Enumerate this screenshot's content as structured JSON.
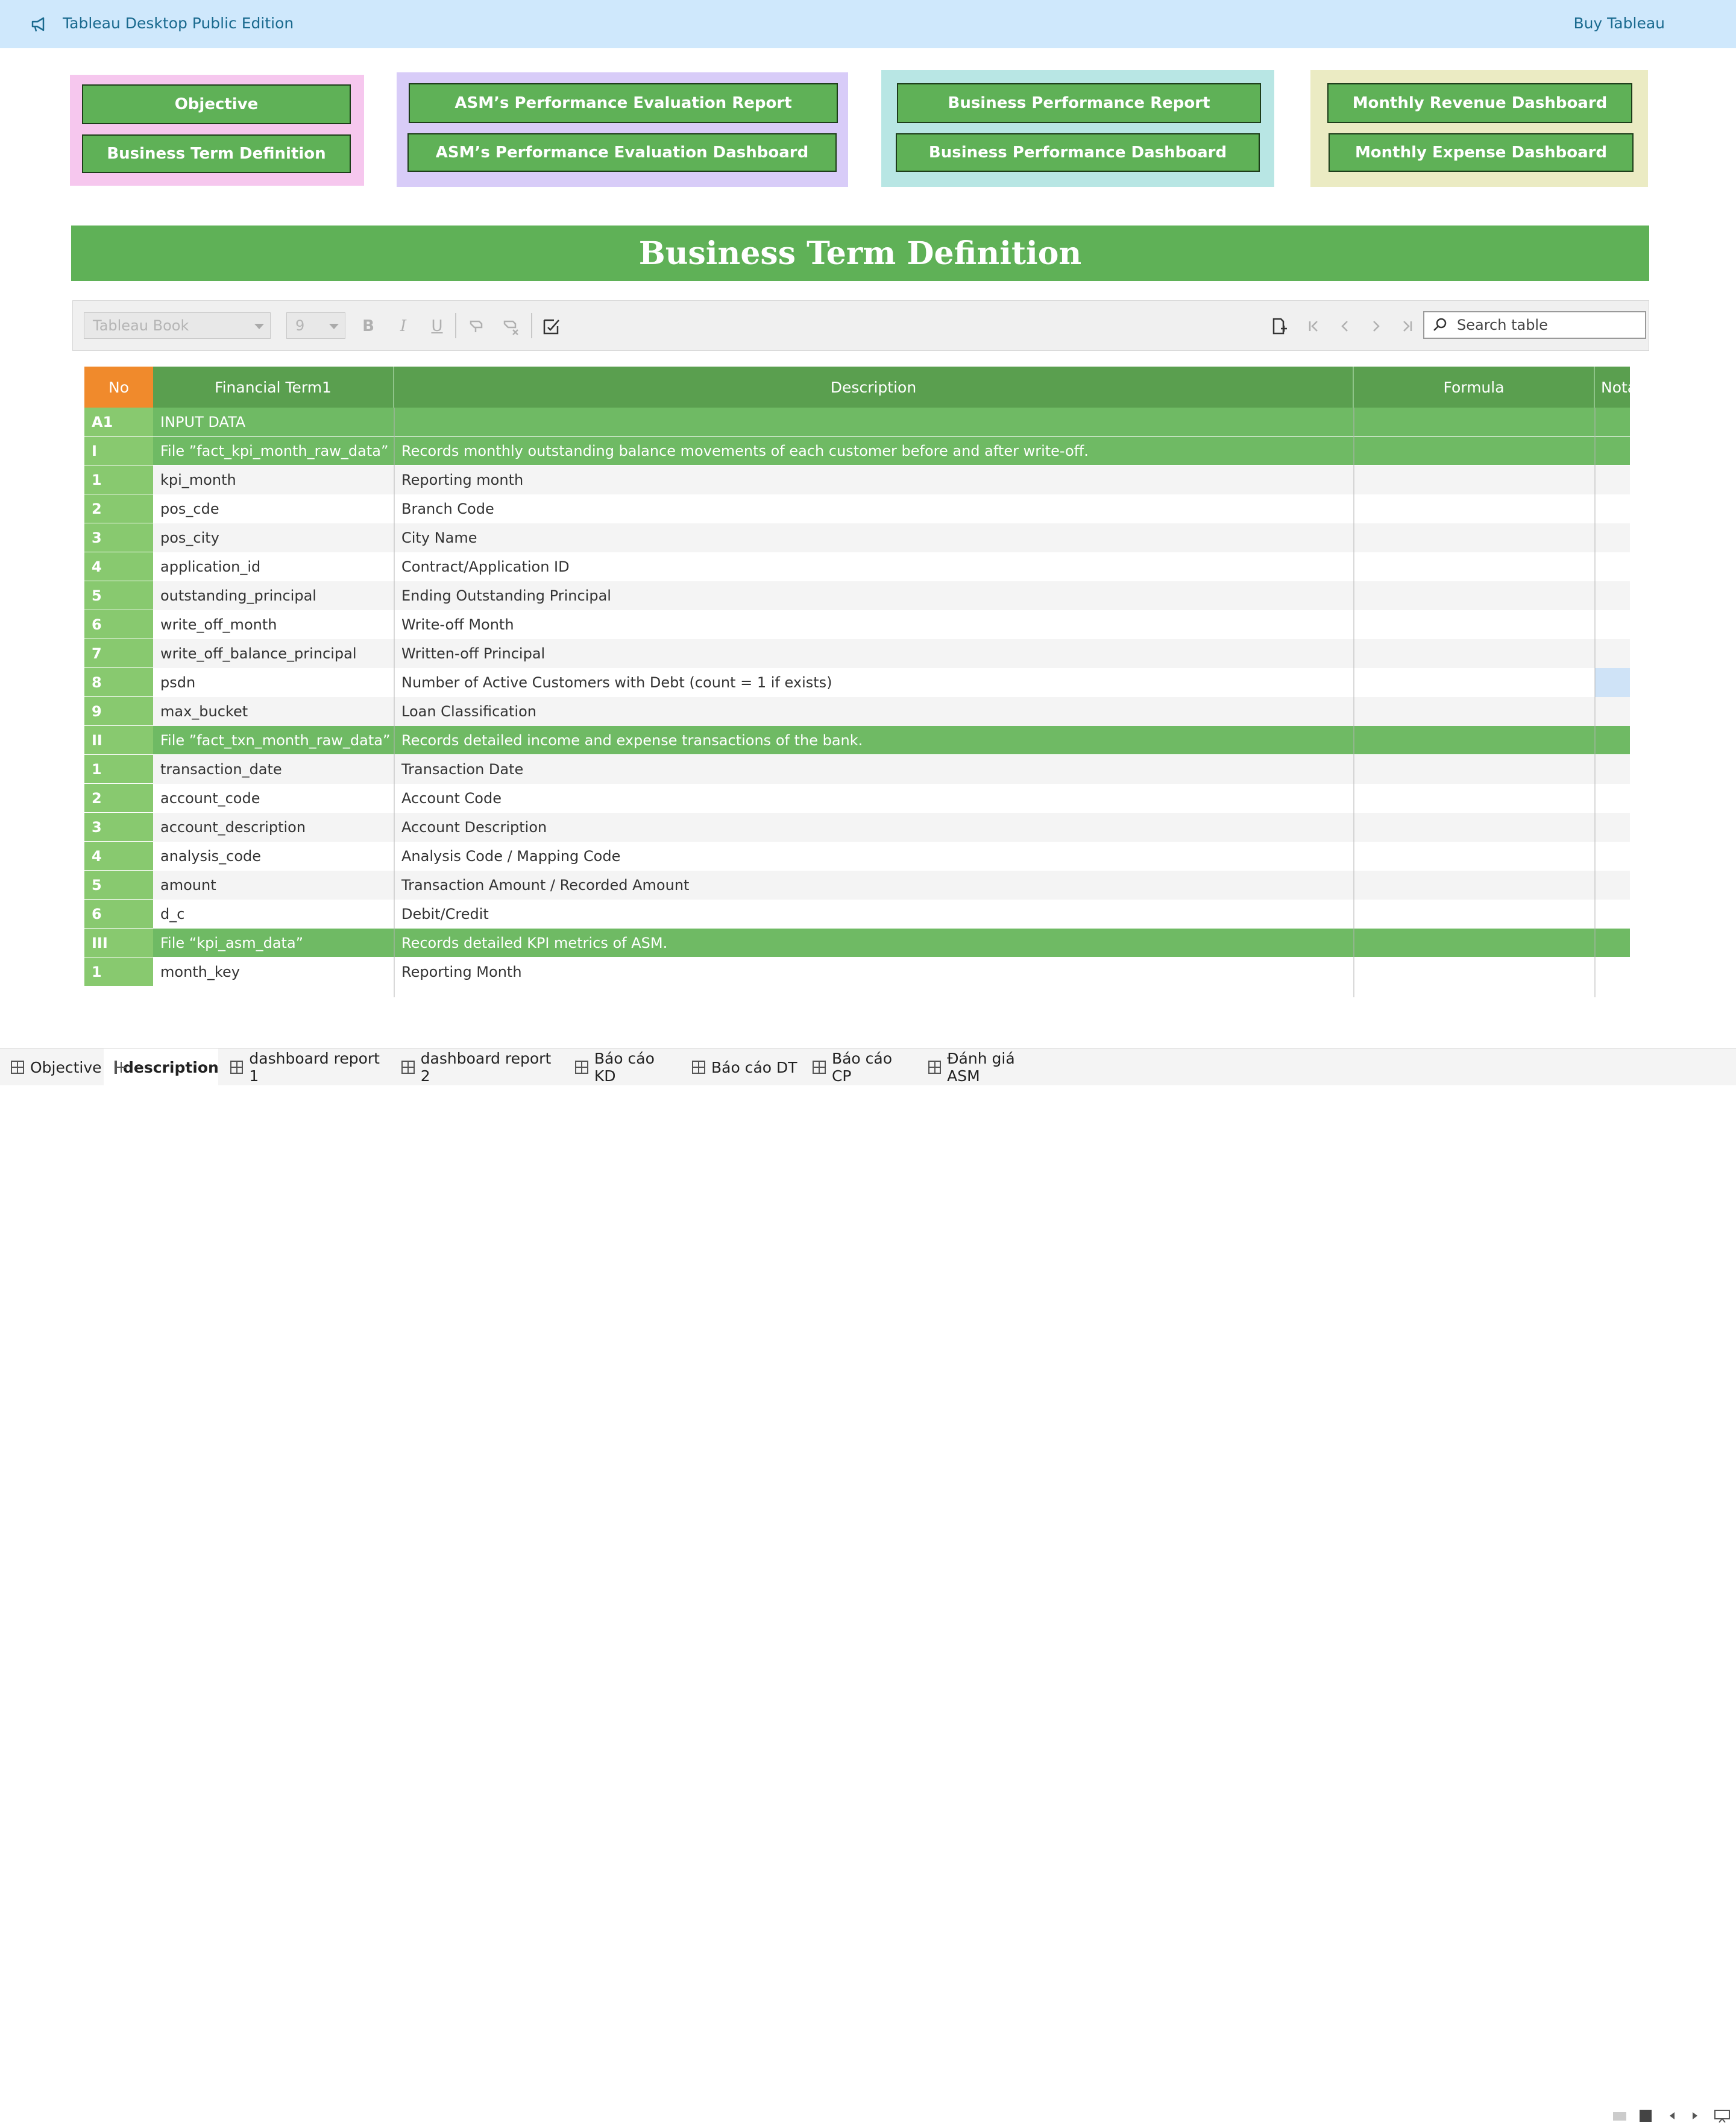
{
  "app": {
    "title": "Tableau Desktop Public Edition",
    "buy_label": "Buy Tableau",
    "icon": "megaphone-icon"
  },
  "nav": {
    "groups": [
      {
        "bg": "#f6c7ee",
        "buttons": [
          "Objective",
          "Business Term Definition"
        ]
      },
      {
        "bg": "#d8ccf8",
        "buttons": [
          "ASM’s Performance Evaluation Report",
          "ASM’s Performance Evaluation Dashboard"
        ]
      },
      {
        "bg": "#b8e6e4",
        "buttons": [
          "Business Performance Report",
          "Business Performance Dashboard"
        ]
      },
      {
        "bg": "#ebebc3",
        "buttons": [
          "Monthly Revenue Dashboard",
          "Monthly Expense Dashboard"
        ]
      }
    ]
  },
  "banner": {
    "title": "Business Term Definition"
  },
  "toolbar": {
    "font_name": "Tableau Book",
    "font_size": "9",
    "search_placeholder": "Search table"
  },
  "table": {
    "headers": [
      "No",
      "Financial Term1",
      "Description",
      "Formula",
      "Nota"
    ],
    "rows": [
      {
        "no": "A1",
        "term": "INPUT DATA",
        "desc": "",
        "kind": "section"
      },
      {
        "no": "I",
        "term": "File ”fact_kpi_month_raw_data”",
        "desc": "Records monthly outstanding balance movements of each customer before and after write-off.",
        "kind": "section"
      },
      {
        "no": "1",
        "term": "kpi_month",
        "desc": "Reporting month",
        "kind": "data"
      },
      {
        "no": "2",
        "term": "pos_cde",
        "desc": "Branch Code",
        "kind": "data"
      },
      {
        "no": "3",
        "term": "pos_city",
        "desc": "City Name",
        "kind": "data"
      },
      {
        "no": "4",
        "term": "application_id",
        "desc": "Contract/Application ID",
        "kind": "data"
      },
      {
        "no": "5",
        "term": "outstanding_principal",
        "desc": "Ending Outstanding Principal",
        "kind": "data"
      },
      {
        "no": "6",
        "term": "write_off_month",
        "desc": "Write-off Month",
        "kind": "data"
      },
      {
        "no": "7",
        "term": "write_off_balance_principal",
        "desc": "Written-off Principal",
        "kind": "data"
      },
      {
        "no": "8",
        "term": "psdn",
        "desc": "Number of Active Customers with Debt (count = 1 if exists)",
        "kind": "data",
        "selected": true
      },
      {
        "no": "9",
        "term": "max_bucket",
        "desc": "Loan Classification",
        "kind": "data"
      },
      {
        "no": "II",
        "term": "File ”fact_txn_month_raw_data”",
        "desc": "Records detailed income and expense transactions of the bank.",
        "kind": "section"
      },
      {
        "no": "1",
        "term": "transaction_date",
        "desc": "Transaction Date",
        "kind": "data"
      },
      {
        "no": "2",
        "term": "account_code",
        "desc": "Account Code",
        "kind": "data"
      },
      {
        "no": "3",
        "term": "account_description",
        "desc": "Account Description",
        "kind": "data"
      },
      {
        "no": "4",
        "term": "analysis_code",
        "desc": "Analysis Code / Mapping Code",
        "kind": "data"
      },
      {
        "no": "5",
        "term": "amount",
        "desc": "Transaction Amount / Recorded Amount",
        "kind": "data"
      },
      {
        "no": "6",
        "term": "d_c",
        "desc": "Debit/Credit",
        "kind": "data"
      },
      {
        "no": "III",
        "term": "File “kpi_asm_data”",
        "desc": "Records detailed KPI metrics of ASM.",
        "kind": "section"
      },
      {
        "no": "1",
        "term": "month_key",
        "desc": "Reporting Month",
        "kind": "data"
      }
    ]
  },
  "tabs": [
    {
      "label": "Objective",
      "active": false
    },
    {
      "label": "description",
      "active": true
    },
    {
      "label": "dashboard report 1",
      "active": false
    },
    {
      "label": "dashboard report 2",
      "active": false
    },
    {
      "label": "Báo cáo KD",
      "active": false
    },
    {
      "label": "Báo cáo DT",
      "active": false
    },
    {
      "label": "Báo cáo CP",
      "active": false
    },
    {
      "label": "Đánh giá ASM",
      "active": false
    }
  ],
  "colors": {
    "header_green": "#5a9f4f",
    "section_green": "#6fba64",
    "no_green": "#88c96f",
    "no_header_orange": "#f08a2c",
    "selected_cell": "#cfe3f7"
  }
}
